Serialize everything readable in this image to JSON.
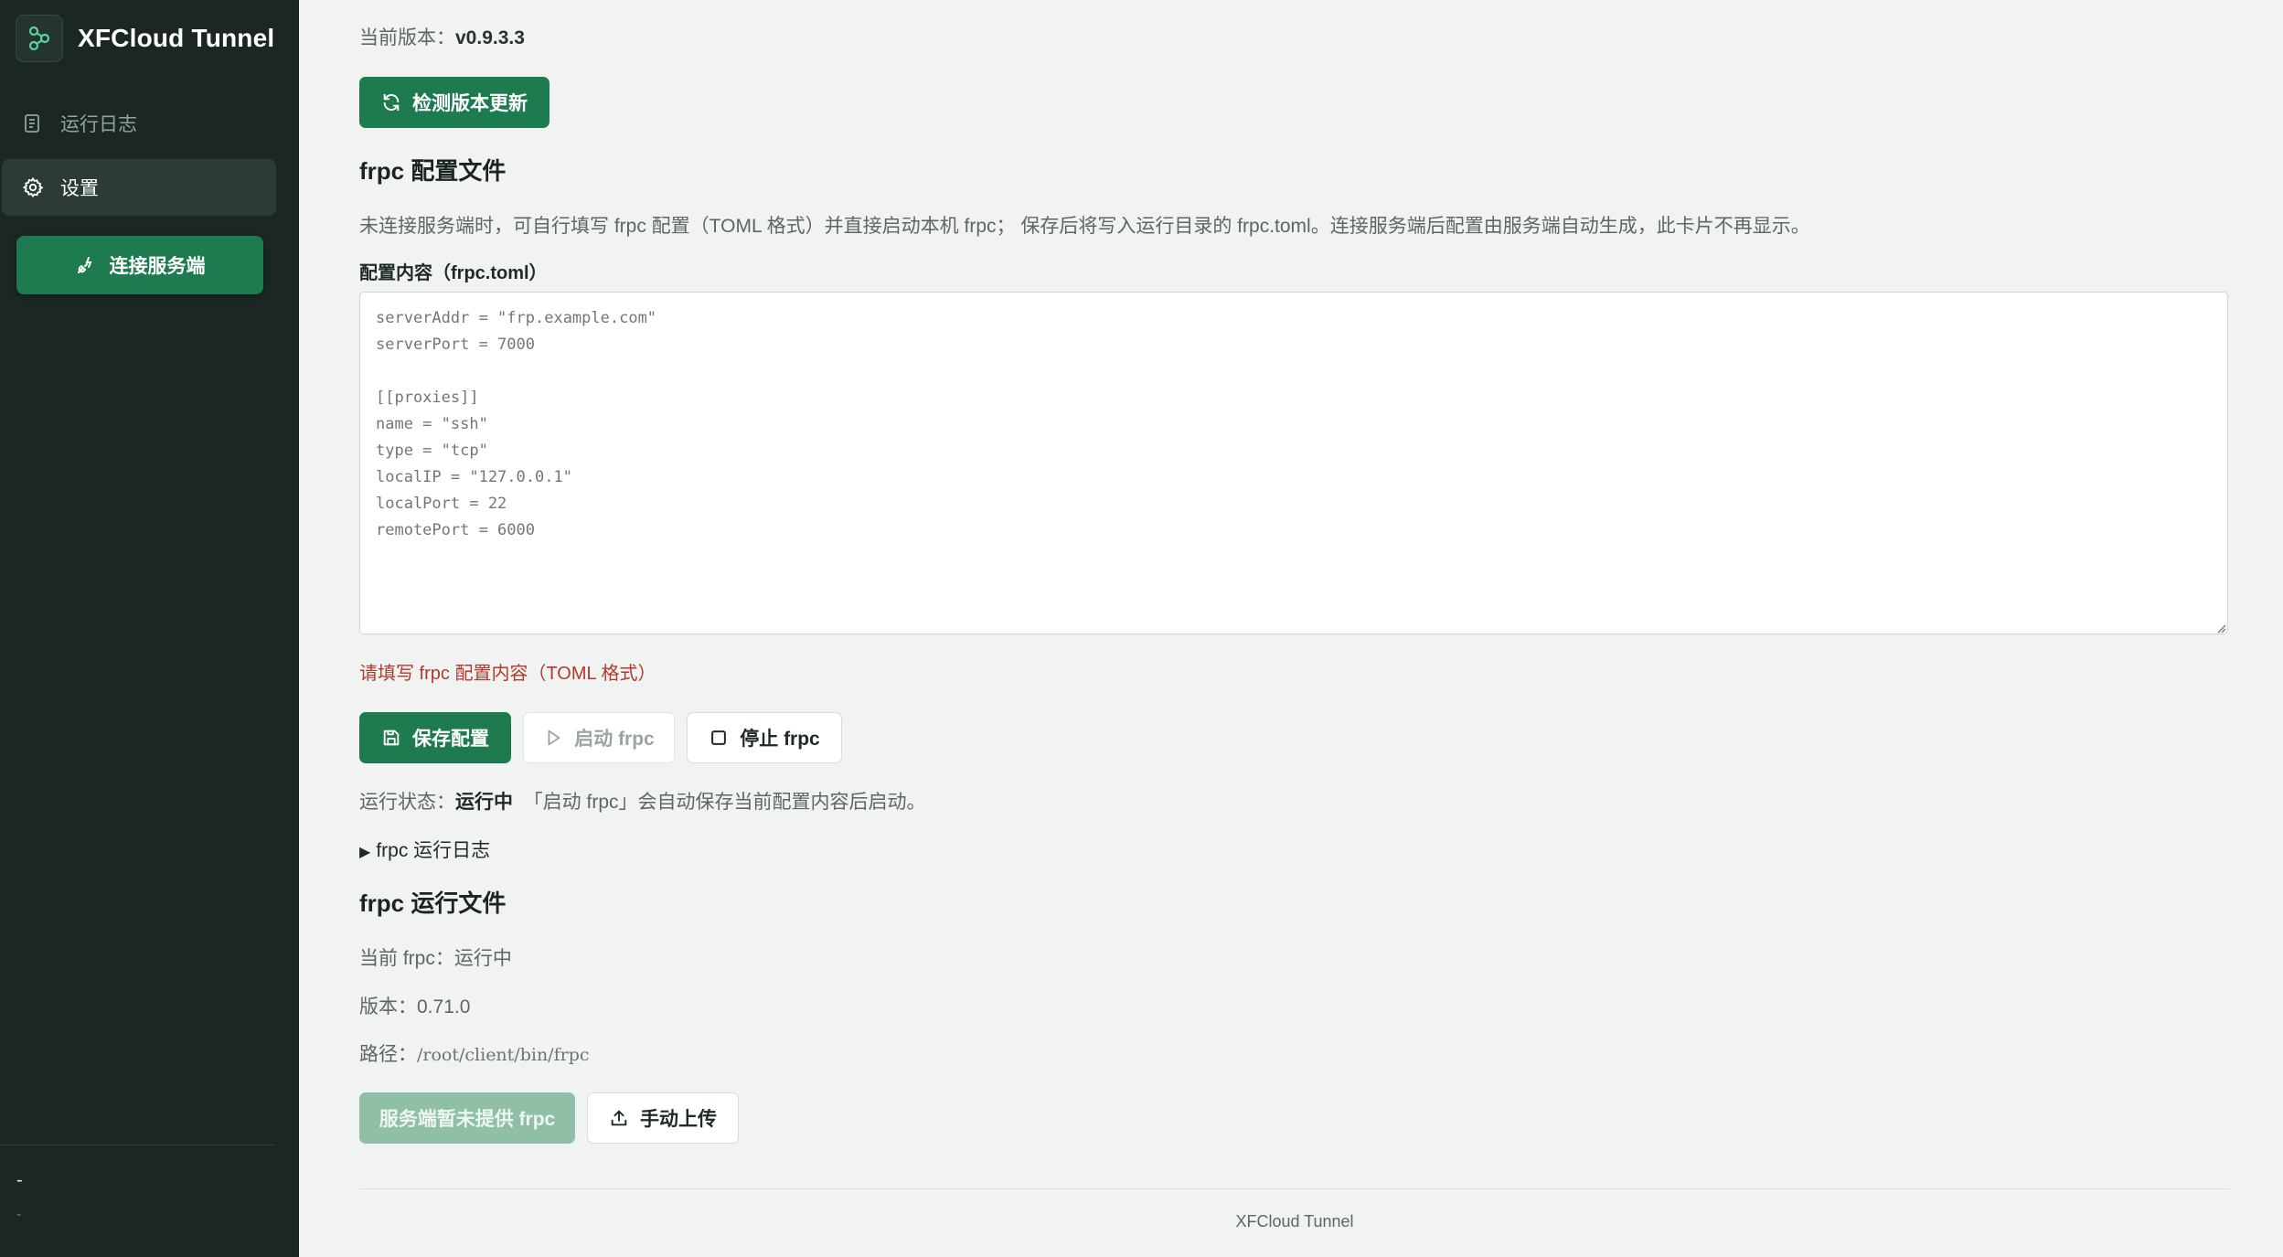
{
  "app": {
    "title": "XFCloud Tunnel"
  },
  "sidebar": {
    "items": [
      {
        "label": "运行日志",
        "icon": "scroll-icon"
      },
      {
        "label": "设置",
        "icon": "gear-icon"
      }
    ],
    "connect_label": "连接服务端",
    "footer_line1": "-",
    "footer_line2": "-"
  },
  "main": {
    "version_prefix": "当前版本：",
    "version_value": "v0.9.3.3",
    "check_update_label": "检测版本更新",
    "config": {
      "title": "frpc 配置文件",
      "description": "未连接服务端时，可自行填写 frpc 配置（TOML 格式）并直接启动本机 frpc； 保存后将写入运行目录的 frpc.toml。连接服务端后配置由服务端自动生成，此卡片不再显示。",
      "field_label": "配置内容（frpc.toml）",
      "placeholder": "serverAddr = \"frp.example.com\"\nserverPort = 7000\n\n[[proxies]]\nname = \"ssh\"\ntype = \"tcp\"\nlocalIP = \"127.0.0.1\"\nlocalPort = 22\nremotePort = 6000",
      "error": "请填写 frpc 配置内容（TOML 格式）",
      "save_label": "保存配置",
      "start_label": "启动 frpc",
      "stop_label": "停止 frpc",
      "status_prefix": "运行状态：",
      "status_value": "运行中",
      "status_note": "「启动 frpc」会自动保存当前配置内容后启动。",
      "logs_toggle": "frpc 运行日志"
    },
    "runtime": {
      "title": "frpc 运行文件",
      "current": "当前 frpc：运行中",
      "version": "版本：0.71.0",
      "path_prefix": "路径：",
      "path_value": "/root/client/bin/frpc",
      "provide_label": "服务端暂未提供 frpc",
      "upload_label": "手动上传"
    },
    "footer": "XFCloud Tunnel"
  },
  "colors": {
    "sidebar_bg": "#1c2724",
    "accent": "#1e7a4f",
    "error": "#b23a2c",
    "main_bg": "#f1f3f2"
  }
}
